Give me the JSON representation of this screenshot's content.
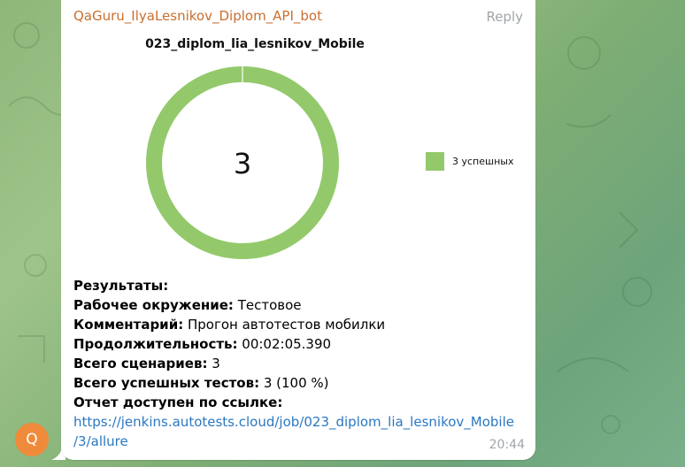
{
  "message": {
    "sender": "QaGuru_IlyaLesnikov_Diplom_API_bot",
    "reply_label": "Reply",
    "time": "20:44",
    "avatar_letter": "Q",
    "avatar_color": "#f08a3b",
    "sender_color": "#c96f2f"
  },
  "chart_data": {
    "type": "pie",
    "title": "023_diplom_lia_lesnikov_Mobile",
    "center_label": "3",
    "slices": [
      {
        "name": "3 успешных",
        "value": 3,
        "color": "#93c96b"
      }
    ],
    "legend_position": "right"
  },
  "results": {
    "heading": "Результаты:",
    "env_label": "Рабочее окружение:",
    "env_value": " Тестовое",
    "comment_label": "Комментарий:",
    "comment_value": " Прогон автотестов мобилки",
    "duration_label": "Продолжительность:",
    "duration_value": " 00:02:05.390",
    "scenarios_label": "Всего сценариев:",
    "scenarios_value": " 3",
    "passed_label": "Всего успешных тестов:",
    "passed_value": " 3 (100 %)",
    "report_label": "Отчет доступен по ссылке:",
    "report_link_line1": "https://jenkins.autotests.cloud/job/023_diplom_lia_lesnikov_Mobile",
    "report_link_line2": "/3/allure"
  }
}
